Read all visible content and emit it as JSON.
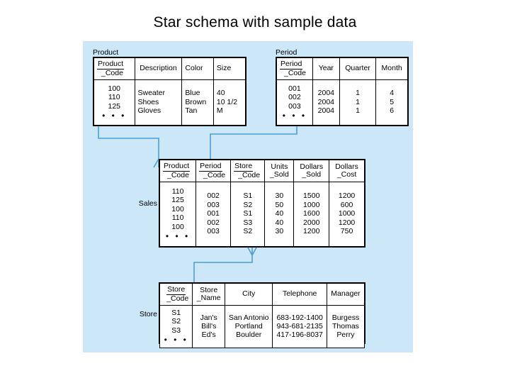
{
  "slide": {
    "title": "Star schema with sample data",
    "panel_color": "#cbe7f8",
    "line_color": "#4b9fd5"
  },
  "tables": {
    "product": {
      "caption": "Product",
      "headers": [
        {
          "line1": "Product",
          "line2": "_Code"
        },
        {
          "line1": "Description",
          "line2": ""
        },
        {
          "line1": "Color",
          "line2": ""
        },
        {
          "line1": "Size",
          "line2": ""
        }
      ],
      "columns": {
        "product_code": [
          "100",
          "110",
          "125"
        ],
        "description": [
          "Sweater",
          "Shoes",
          "Gloves"
        ],
        "color": [
          "Blue",
          "Brown",
          "Tan"
        ],
        "size": [
          "40",
          "10 1/2",
          "M"
        ]
      },
      "more_indicator": "• • •"
    },
    "period": {
      "caption": "Period",
      "headers": [
        {
          "line1": "Period",
          "line2": "_Code"
        },
        {
          "line1": "Year",
          "line2": ""
        },
        {
          "line1": "Quarter",
          "line2": ""
        },
        {
          "line1": "Month",
          "line2": ""
        }
      ],
      "columns": {
        "period_code": [
          "001",
          "002",
          "003"
        ],
        "year": [
          "2004",
          "2004",
          "2004"
        ],
        "quarter": [
          "1",
          "1",
          "1"
        ],
        "month": [
          "4",
          "5",
          "6"
        ]
      },
      "more_indicator": "• • •"
    },
    "sales": {
      "caption": "Sales",
      "headers": [
        {
          "line1": "Product",
          "line2": "_Code"
        },
        {
          "line1": "Period",
          "line2": "_Code"
        },
        {
          "line1": "Store",
          "line2": "_Code"
        },
        {
          "line1": "Units",
          "line2": "_Sold"
        },
        {
          "line1": "Dollars",
          "line2": "_Sold"
        },
        {
          "line1": "Dollars",
          "line2": "_Cost"
        }
      ],
      "columns": {
        "product_code": [
          "110",
          "125",
          "100",
          "110",
          "100"
        ],
        "period_code": [
          "002",
          "003",
          "001",
          "002",
          "003"
        ],
        "store_code": [
          "S1",
          "S2",
          "S1",
          "S3",
          "S2"
        ],
        "units_sold": [
          "30",
          "50",
          "40",
          "40",
          "30"
        ],
        "dollars_sold": [
          "1500",
          "1000",
          "1600",
          "2000",
          "1200"
        ],
        "dollars_cost": [
          "1200",
          "600",
          "1000",
          "1200",
          "750"
        ]
      },
      "more_indicator": "• • •"
    },
    "store": {
      "caption": "Store",
      "headers": [
        {
          "line1": "Store",
          "line2": "_Code"
        },
        {
          "line1": "Store",
          "line2": "_Name"
        },
        {
          "line1": "City",
          "line2": ""
        },
        {
          "line1": "Telephone",
          "line2": ""
        },
        {
          "line1": "Manager",
          "line2": ""
        }
      ],
      "columns": {
        "store_code": [
          "S1",
          "S2",
          "S3"
        ],
        "store_name": [
          "Jan's",
          "Bill's",
          "Ed's"
        ],
        "city": [
          "San Antonio",
          "Portland",
          "Boulder"
        ],
        "telephone": [
          "683-192-1400",
          "943-681-2135",
          "417-196-8037"
        ],
        "manager": [
          "Burgess",
          "Thomas",
          "Perry"
        ]
      },
      "more_indicator": "• • •"
    }
  }
}
